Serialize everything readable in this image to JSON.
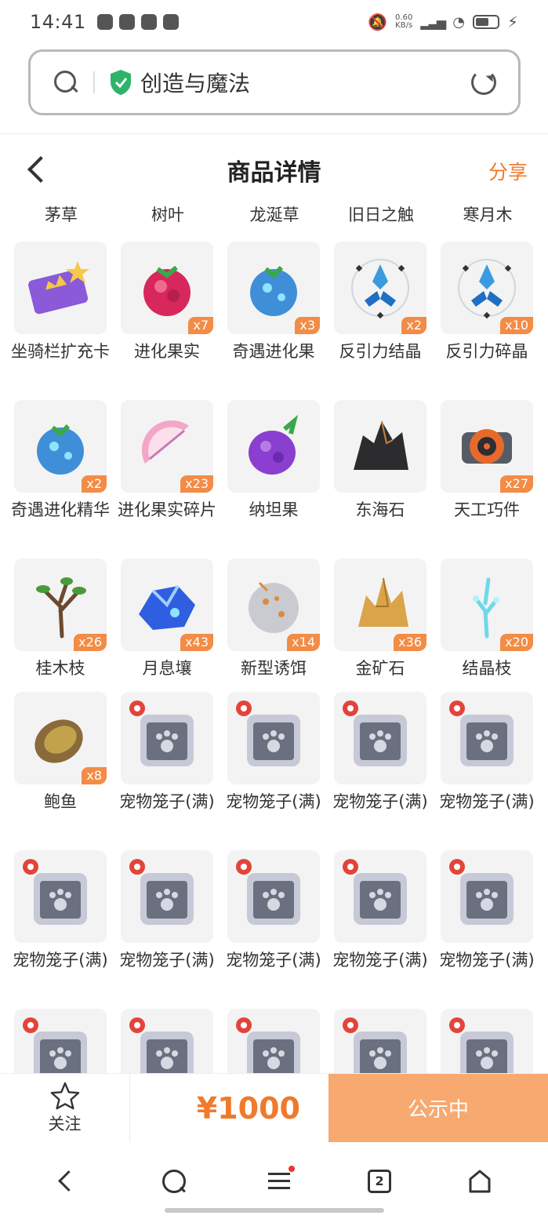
{
  "status_bar": {
    "time": "14:41",
    "speed_value": "0.60",
    "speed_unit": "KB/s"
  },
  "browser": {
    "site_title": "创造与魔法"
  },
  "header": {
    "title": "商品详情",
    "share_label": "分享"
  },
  "top_row": [
    "茅草",
    "树叶",
    "龙涎草",
    "旧日之触",
    "寒月木"
  ],
  "items": [
    {
      "name": "坐骑栏扩充卡",
      "qty": "",
      "icon": "card-icon"
    },
    {
      "name": "进化果实",
      "qty": "x7",
      "icon": "raspberry-icon"
    },
    {
      "name": "奇遇进化果",
      "qty": "x3",
      "icon": "blue-fruit-icon"
    },
    {
      "name": "反引力结晶",
      "qty": "x2",
      "icon": "crystal-icon"
    },
    {
      "name": "反引力碎晶",
      "qty": "x10",
      "icon": "crystal-icon"
    },
    {
      "name": "奇遇进化精华",
      "qty": "x2",
      "icon": "blue-fruit-icon"
    },
    {
      "name": "进化果实碎片",
      "qty": "x23",
      "icon": "fruit-slice-icon"
    },
    {
      "name": "纳坦果",
      "qty": "",
      "icon": "purple-berry-icon"
    },
    {
      "name": "东海石",
      "qty": "",
      "icon": "black-rock-icon"
    },
    {
      "name": "天工巧件",
      "qty": "x27",
      "icon": "gear-part-icon"
    },
    {
      "name": "桂木枝",
      "qty": "x26",
      "icon": "branch-icon"
    },
    {
      "name": "月息壤",
      "qty": "x43",
      "icon": "blue-soil-icon"
    },
    {
      "name": "新型诱饵",
      "qty": "x14",
      "icon": "bait-icon"
    },
    {
      "name": "金矿石",
      "qty": "x36",
      "icon": "gold-ore-icon"
    },
    {
      "name": "结晶枝",
      "qty": "x20",
      "icon": "crystal-branch-icon"
    },
    {
      "name": "鲍鱼",
      "qty": "x8",
      "icon": "abalone-icon"
    },
    {
      "name": "宠物笼子(满)",
      "qty": "",
      "icon": "pet-cage-icon"
    },
    {
      "name": "宠物笼子(满)",
      "qty": "",
      "icon": "pet-cage-icon"
    },
    {
      "name": "宠物笼子(满)",
      "qty": "",
      "icon": "pet-cage-icon"
    },
    {
      "name": "宠物笼子(满)",
      "qty": "",
      "icon": "pet-cage-icon"
    },
    {
      "name": "宠物笼子(满)",
      "qty": "",
      "icon": "pet-cage-icon"
    },
    {
      "name": "宠物笼子(满)",
      "qty": "",
      "icon": "pet-cage-icon"
    },
    {
      "name": "宠物笼子(满)",
      "qty": "",
      "icon": "pet-cage-icon"
    },
    {
      "name": "宠物笼子(满)",
      "qty": "",
      "icon": "pet-cage-icon"
    },
    {
      "name": "宠物笼子(满)",
      "qty": "",
      "icon": "pet-cage-icon"
    },
    {
      "name": "",
      "qty": "",
      "icon": "pet-cage-icon"
    },
    {
      "name": "",
      "qty": "",
      "icon": "pet-cage-icon"
    },
    {
      "name": "",
      "qty": "",
      "icon": "pet-cage-icon"
    },
    {
      "name": "",
      "qty": "",
      "icon": "pet-cage-icon"
    },
    {
      "name": "",
      "qty": "",
      "icon": "pet-cage-icon"
    }
  ],
  "bottom_bar": {
    "follow_label": "关注",
    "price": "¥1000",
    "status_label": "公示中"
  },
  "nav": {
    "tab_count": "2"
  },
  "colors": {
    "accent": "#f07a2b",
    "status_button": "#f8a970",
    "qty_badge": "#f28c46"
  }
}
